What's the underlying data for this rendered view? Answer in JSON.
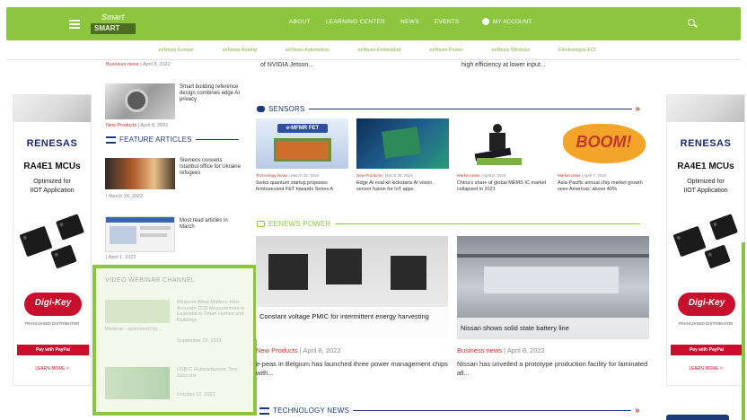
{
  "nav": {
    "logo_top": "Smart",
    "logo_bottom": "SMART",
    "items": [
      "ABOUT",
      "LEARNING CENTER",
      "NEWS",
      "EVENTS"
    ],
    "account": "MY ACCOUNT"
  },
  "subnav": [
    "eeNews Europe",
    "eeNews Analog",
    "eeNews Automotive",
    "eeNews Embedded",
    "eeNews Power",
    "eeNews Wireless",
    "Electronique-ECI"
  ],
  "left": {
    "top_label": "Business news",
    "top_date": "| April 8, 2022",
    "item1_title": "Smart building reference design combines edge AI privacy",
    "item1_label": "New Products",
    "item1_date": "| April 8, 2022",
    "feature_title": "FEATURE ARTICLES",
    "fa1_title": "Siemens converts Istanbul office for Ukraine refugees",
    "fa1_date": "| March 28, 2022",
    "fa2_title": "Most read articles in March",
    "fa2_date": "| April 1, 2022"
  },
  "webinar": {
    "title": "VIDEO WEBINAR CHANNEL",
    "w1_title": "Measure What Matters: How Accurate CO2 Measurement is Essential to Smart Homes and Buildings",
    "w1_meta": "Webinar - sponsored by ...",
    "w1_date": "September 22, 2021",
    "w2_title": "USB-C Hubs/adaptors: Test Step one",
    "w2_date": "October 12, 2021"
  },
  "top_snippets": {
    "mid": "of NVIDIA Jetson...",
    "right": "high efficiency at lower input..."
  },
  "sensors": {
    "title": "SENSORS",
    "arrow": "»",
    "items": [
      {
        "img_text": "e-MFMR FET",
        "cat": "Technology News",
        "date": "| March 29, 2022",
        "desc": "Swiss quantum startup proposes femtosecond FET towards Series A"
      },
      {
        "img_text": "",
        "cat": "New Products",
        "date": "| March 30, 2022",
        "desc": "Edge AI eval kit kickstarts AI vision, sensor fusion for IoT apps"
      },
      {
        "img_text": "",
        "cat": "Market news",
        "date": "| April 8, 2022",
        "desc": "China's share of global MEMS IC market collapsed in 2021"
      },
      {
        "img_text": "BOOM!",
        "cat": "Market news",
        "date": "| April 7, 2022",
        "desc": "Asia-Pacific annual chip market growth sees Americas' above 40%"
      }
    ]
  },
  "power": {
    "title": "EENEWS POWER",
    "arrow": "»",
    "items": [
      {
        "caption": "Constant voltage PMIC for intermittent energy harvesting",
        "cat": "New Products",
        "date": "| April 8, 2022",
        "desc": "e-peas in Belgium has launched three power management chips with..."
      },
      {
        "caption": "Nissan shows solid state battery line",
        "cat": "Business news",
        "date": "| April 8, 2022",
        "desc": "Nissan has unveiled a prototype production facility for laminated all..."
      }
    ]
  },
  "technology": {
    "title": "TECHNOLOGY NEWS",
    "arrow": "»"
  },
  "ad": {
    "brand": "RENESAS",
    "product": "RA4E1 MCUs",
    "sub1": "Optimized for",
    "sub2": "IIOT Application",
    "distributor": "Digi-Key",
    "dist_sub": "FRANCHISED DISTRIBUTOR",
    "paypal": "Pay with PayPal",
    "learn": "LEARN MORE >"
  },
  "colors": {
    "brand_green": "#8cc63f",
    "heading_blue": "#1a3a7a",
    "label_red": "#c0392b"
  }
}
